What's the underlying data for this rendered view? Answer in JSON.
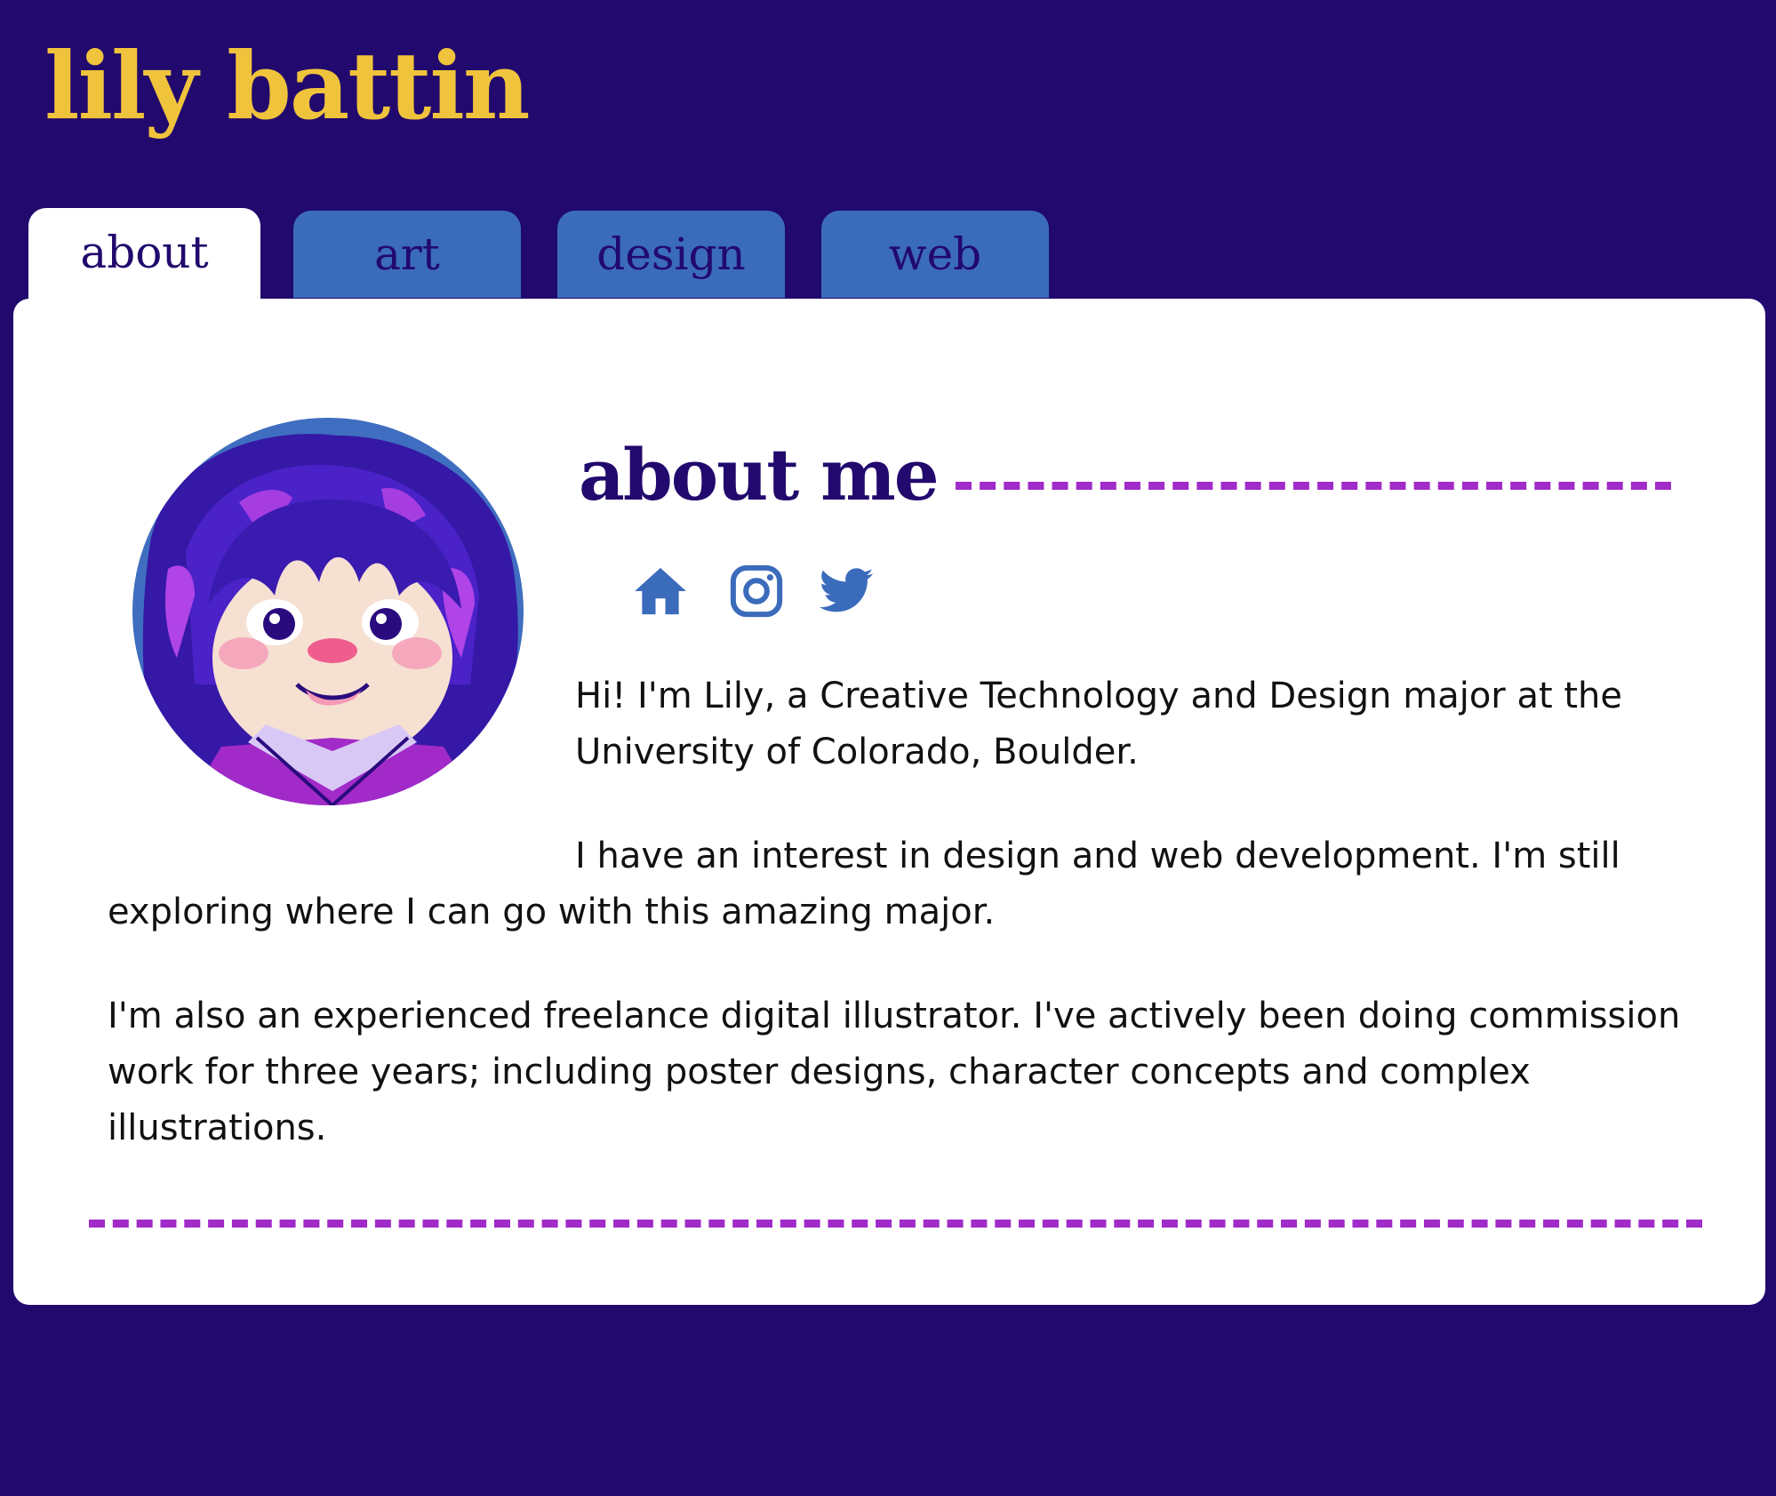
{
  "site": {
    "title": "lily battin"
  },
  "nav": {
    "tabs": [
      {
        "label": "about",
        "active": true
      },
      {
        "label": "art",
        "active": false
      },
      {
        "label": "design",
        "active": false
      },
      {
        "label": "web",
        "active": false
      }
    ]
  },
  "about": {
    "heading": "about me",
    "social": [
      {
        "icon": "home-icon"
      },
      {
        "icon": "instagram-icon"
      },
      {
        "icon": "twitter-icon"
      }
    ],
    "paragraphs": [
      "Hi! I'm Lily, a Creative Technology and Design major at the University of Colorado, Boulder.",
      "I have an interest in design and web development. I'm still exploring where I can go with this amazing major.",
      "I'm also an experienced freelance digital illustrator. I've actively been doing commission work for three years; including poster designs, character concepts and complex illustrations."
    ]
  },
  "colors": {
    "background": "#21096d",
    "title": "#f0c33c",
    "tab": "#3b6bbb",
    "accent": "#a12bc8",
    "icon": "#3b6bbb"
  }
}
